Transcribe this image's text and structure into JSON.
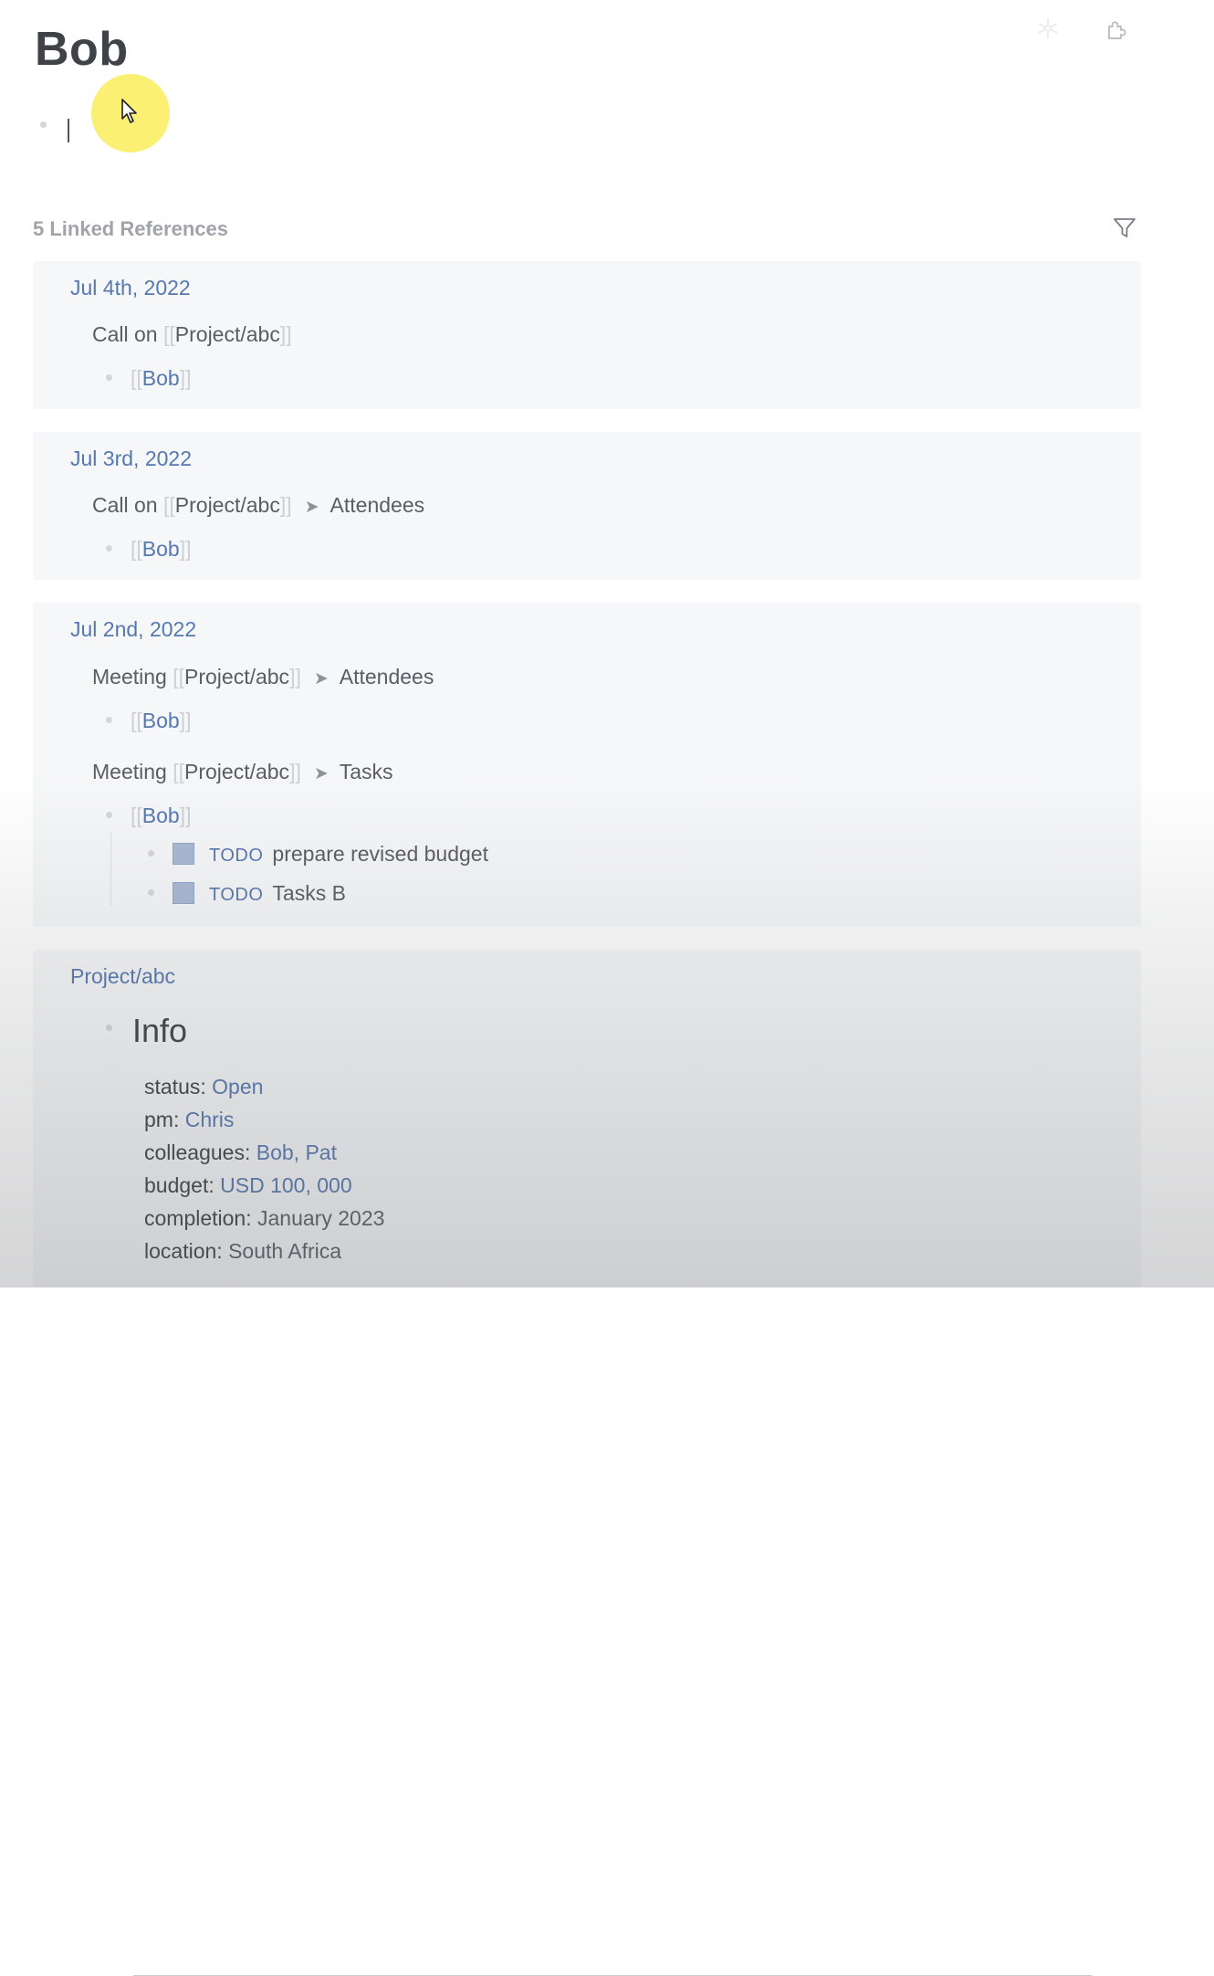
{
  "page": {
    "title": "Bob"
  },
  "linked_references": {
    "count_label": "5 Linked References"
  },
  "references": [
    {
      "title": "Jul 4th, 2022",
      "blocks": [
        {
          "prefix": "Call on",
          "page": "Project/abc",
          "child": "Bob"
        }
      ]
    },
    {
      "title": "Jul 3rd, 2022",
      "blocks": [
        {
          "prefix": "Call on",
          "page": "Project/abc",
          "section": "Attendees",
          "child": "Bob"
        }
      ]
    },
    {
      "title": "Jul 2nd, 2022",
      "blocks": [
        {
          "prefix": "Meeting",
          "page": "Project/abc",
          "section": "Attendees",
          "child": "Bob"
        },
        {
          "prefix": "Meeting",
          "page": "Project/abc",
          "section": "Tasks",
          "child": "Bob",
          "todos": [
            {
              "marker": "TODO",
              "text": "prepare revised budget"
            },
            {
              "marker": "TODO",
              "text": "Tasks B"
            }
          ]
        }
      ]
    },
    {
      "title": "Project/abc",
      "heading": "Info",
      "properties": [
        {
          "key": "status",
          "value": "Open"
        },
        {
          "key": "pm",
          "value": "Chris"
        },
        {
          "key": "colleagues",
          "value": "Bob, Pat"
        },
        {
          "key": "budget",
          "value": "USD 100, 000"
        },
        {
          "key": "completion",
          "value": "January 2023"
        },
        {
          "key": "location",
          "value": "South Africa"
        }
      ]
    }
  ],
  "icons": {
    "top_left": "graph-icon",
    "top_right": "puzzle-icon",
    "filter": "filter-icon",
    "cursor": "mouse-pointer-icon"
  },
  "colors": {
    "link": "#5678b0",
    "text": "#5a5d63",
    "card_bg": "#f6f7f9",
    "cursor_highlight": "#faec5c",
    "todo_box": "#a9b8d4"
  }
}
